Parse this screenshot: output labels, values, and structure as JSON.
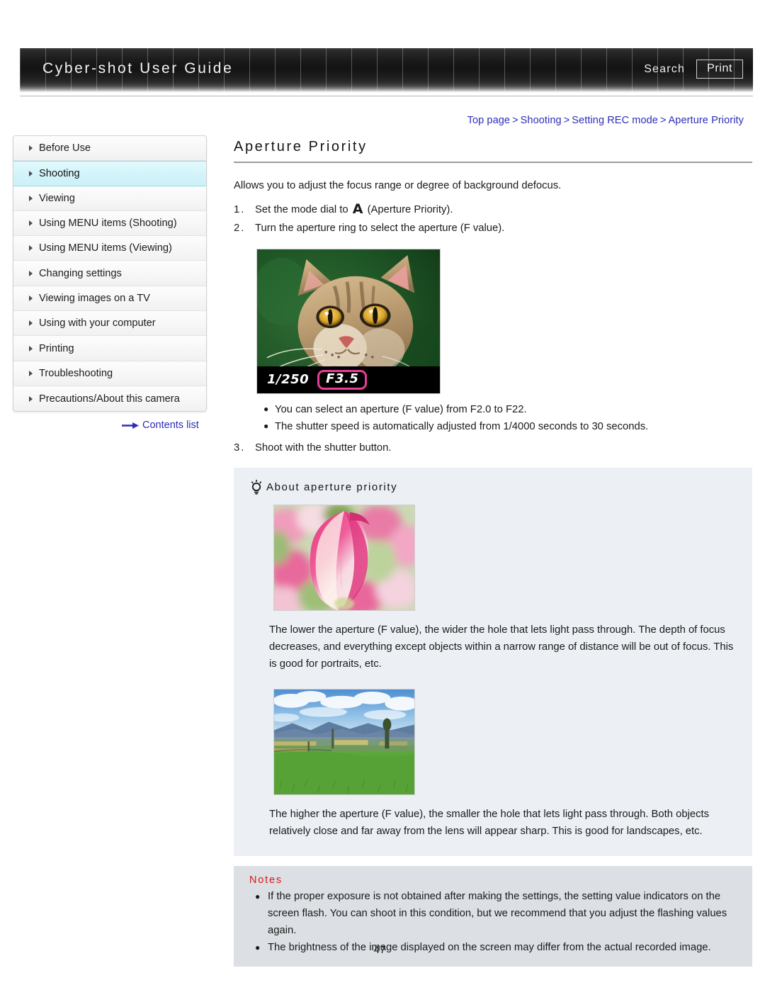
{
  "header": {
    "site_title": "Cyber-shot User Guide",
    "search_label": "Search",
    "print_label": "Print"
  },
  "breadcrumb": {
    "items": [
      "Top page",
      "Shooting",
      "Setting REC mode",
      "Aperture Priority"
    ],
    "separator": ">"
  },
  "sidebar": {
    "items": [
      {
        "label": "Before Use",
        "active": false
      },
      {
        "label": "Shooting",
        "active": true
      },
      {
        "label": "Viewing",
        "active": false
      },
      {
        "label": "Using MENU items (Shooting)",
        "active": false
      },
      {
        "label": "Using MENU items (Viewing)",
        "active": false
      },
      {
        "label": "Changing settings",
        "active": false
      },
      {
        "label": "Viewing images on a TV",
        "active": false
      },
      {
        "label": "Using with your computer",
        "active": false
      },
      {
        "label": "Printing",
        "active": false
      },
      {
        "label": "Troubleshooting",
        "active": false
      },
      {
        "label": "Precautions/About this camera",
        "active": false
      }
    ],
    "contents_link": "Contents list"
  },
  "main": {
    "title": "Aperture Priority",
    "lead": "Allows you to adjust the focus range or degree of background defocus.",
    "steps": [
      {
        "num": "1.",
        "text_before": "Set the mode dial to ",
        "mode_glyph": "A",
        "text_after": " (Aperture Priority)."
      },
      {
        "num": "2.",
        "text_before": "Turn the aperture ring to select the aperture (F value).",
        "mode_glyph": "",
        "text_after": ""
      },
      {
        "num": "3.",
        "text_before": "Shoot with the shutter button.",
        "mode_glyph": "",
        "text_after": ""
      }
    ],
    "camera_shot": {
      "alt": "cat-photo-with-camera-osd",
      "shutter_speed": "1/250",
      "f_value": "F3.5",
      "highlight_color": "#ec3b9a"
    },
    "bullets": [
      "You can select an aperture (F value) from F2.0 to F22.",
      "The shutter speed is automatically adjusted from 1/4000 seconds to 30 seconds."
    ]
  },
  "tip": {
    "heading": "About aperture priority",
    "photo_low_alt": "pink-tulip-shallow-depth-of-field",
    "text_low": "The lower the aperture (F value), the wider the hole that lets light pass through. The depth of focus decreases, and everything except objects within a narrow range of distance will be out of focus. This is good for portraits, etc.",
    "photo_high_alt": "green-field-landscape-deep-depth-of-field",
    "text_high": "The higher the aperture (F value), the smaller the hole that lets light pass through. Both objects relatively close and far away from the lens will appear sharp. This is good for landscapes, etc."
  },
  "notes": {
    "title": "Notes",
    "items": [
      "If the proper exposure is not obtained after making the settings, the setting value indicators on the screen flash. You can shoot in this condition, but we recommend that you adjust the flashing values again.",
      "The brightness of the image displayed on the screen may differ from the actual recorded image."
    ]
  },
  "footer": {
    "page_number": "47"
  },
  "colors": {
    "link": "#2d2db8",
    "active_sidebar": "#cdf1f8",
    "notes_title": "#d81818",
    "tip_panel_bg": "#eceff3",
    "notes_panel_bg": "#dcdfe4"
  }
}
